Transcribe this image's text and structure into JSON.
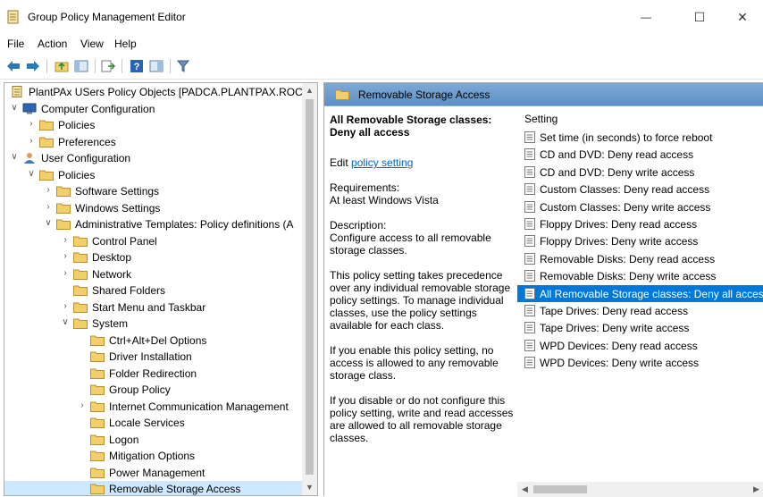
{
  "window": {
    "title": "Group Policy Management Editor",
    "minimize_glyph": "—",
    "maximize_glyph": "☐",
    "close_glyph": "✕"
  },
  "menu": [
    "File",
    "Action",
    "View",
    "Help"
  ],
  "toolbar_icons": [
    "back-arrow-icon",
    "forward-arrow-icon",
    "up-folder-icon",
    "show-hide-tree-icon",
    "export-list-icon",
    "help-icon",
    "properties-pane-icon",
    "filter-icon"
  ],
  "tree": [
    {
      "label": "PlantPAx USers Policy Objects [PADCA.PLANTPAX.ROCK\\",
      "level": 0,
      "chevron": "",
      "icon": "policy-document-icon"
    },
    {
      "label": "Computer Configuration",
      "level": 0,
      "chevron": "down",
      "icon": "computer-icon"
    },
    {
      "label": "Policies",
      "level": 1,
      "chevron": "right",
      "icon": "folder-icon"
    },
    {
      "label": "Preferences",
      "level": 1,
      "chevron": "right",
      "icon": "folder-icon"
    },
    {
      "label": "User Configuration",
      "level": 0,
      "chevron": "down",
      "icon": "user-icon"
    },
    {
      "label": "Policies",
      "level": 1,
      "chevron": "down",
      "icon": "folder-icon"
    },
    {
      "label": "Software Settings",
      "level": 2,
      "chevron": "right",
      "icon": "folder-icon"
    },
    {
      "label": "Windows Settings",
      "level": 2,
      "chevron": "right",
      "icon": "folder-icon"
    },
    {
      "label": "Administrative Templates: Policy definitions (A",
      "level": 2,
      "chevron": "down",
      "icon": "folder-icon"
    },
    {
      "label": "Control Panel",
      "level": 3,
      "chevron": "right",
      "icon": "folder-icon"
    },
    {
      "label": "Desktop",
      "level": 3,
      "chevron": "right",
      "icon": "folder-icon"
    },
    {
      "label": "Network",
      "level": 3,
      "chevron": "right",
      "icon": "folder-icon"
    },
    {
      "label": "Shared Folders",
      "level": 3,
      "chevron": "",
      "icon": "folder-icon"
    },
    {
      "label": "Start Menu and Taskbar",
      "level": 3,
      "chevron": "right",
      "icon": "folder-icon"
    },
    {
      "label": "System",
      "level": 3,
      "chevron": "down",
      "icon": "folder-icon"
    },
    {
      "label": "Ctrl+Alt+Del Options",
      "level": 4,
      "chevron": "",
      "icon": "folder-icon"
    },
    {
      "label": "Driver Installation",
      "level": 4,
      "chevron": "",
      "icon": "folder-icon"
    },
    {
      "label": "Folder Redirection",
      "level": 4,
      "chevron": "",
      "icon": "folder-icon"
    },
    {
      "label": "Group Policy",
      "level": 4,
      "chevron": "",
      "icon": "folder-icon"
    },
    {
      "label": "Internet Communication Management",
      "level": 4,
      "chevron": "right",
      "icon": "folder-icon"
    },
    {
      "label": "Locale Services",
      "level": 4,
      "chevron": "",
      "icon": "folder-icon"
    },
    {
      "label": "Logon",
      "level": 4,
      "chevron": "",
      "icon": "folder-icon"
    },
    {
      "label": "Mitigation Options",
      "level": 4,
      "chevron": "",
      "icon": "folder-icon"
    },
    {
      "label": "Power Management",
      "level": 4,
      "chevron": "",
      "icon": "folder-icon"
    },
    {
      "label": "Removable Storage Access",
      "level": 4,
      "chevron": "",
      "icon": "folder-icon",
      "selected": true
    }
  ],
  "right_pane": {
    "header": "Removable Storage Access",
    "extended": {
      "title": "All Removable Storage classes: Deny all access",
      "edit_prefix": "Edit ",
      "edit_link": "policy setting",
      "requirements_label": "Requirements:",
      "requirements_value": "At least Windows Vista",
      "description_label": "Description:",
      "description": "Configure access to all removable storage classes.",
      "para1": "This policy setting takes precedence over any individual removable storage policy settings. To manage individual classes, use the policy settings available for each class.",
      "para2": "If you enable this policy setting, no access is allowed to any removable storage class.",
      "para3": "If you disable or do not configure this policy setting, write and read accesses are allowed to all removable storage classes."
    },
    "column_header": "Setting",
    "settings": [
      "Set time (in seconds) to force reboot",
      "CD and DVD: Deny read access",
      "CD and DVD: Deny write access",
      "Custom Classes: Deny read access",
      "Custom Classes: Deny write access",
      "Floppy Drives: Deny read access",
      "Floppy Drives: Deny write access",
      "Removable Disks: Deny read access",
      "Removable Disks: Deny write access",
      "All Removable Storage classes: Deny all access",
      "Tape Drives: Deny read access",
      "Tape Drives: Deny write access",
      "WPD Devices: Deny read access",
      "WPD Devices: Deny write access"
    ],
    "selected_setting_index": 9
  },
  "colors": {
    "selection_blue": "#0078d7",
    "tree_selection": "#cde8ff",
    "header_blue": "#6c9bcc",
    "folder_yellow": "#f2cf6b"
  }
}
